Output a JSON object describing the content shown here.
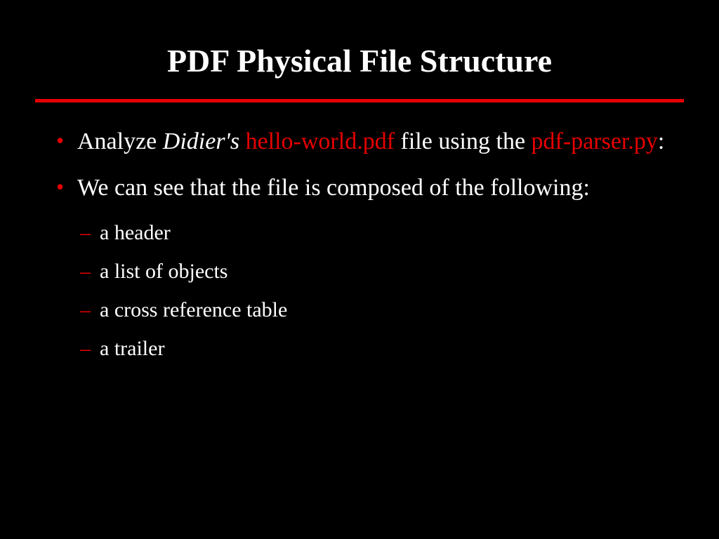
{
  "title": "PDF Physical File Structure",
  "bullets": [
    {
      "segments": [
        {
          "text": "Analyze ",
          "class": ""
        },
        {
          "text": "Didier's",
          "class": "italic"
        },
        {
          "text": " ",
          "class": ""
        },
        {
          "text": "hello-world.pdf",
          "class": "red"
        },
        {
          "text": " file using the ",
          "class": ""
        },
        {
          "text": "pdf-parser.py",
          "class": "red"
        },
        {
          "text": ":",
          "class": ""
        }
      ]
    },
    {
      "segments": [
        {
          "text": "We can see that the file is composed of the following:",
          "class": ""
        }
      ]
    }
  ],
  "sub_items": [
    "a header",
    "a list of objects",
    "a cross reference table",
    "a trailer"
  ]
}
